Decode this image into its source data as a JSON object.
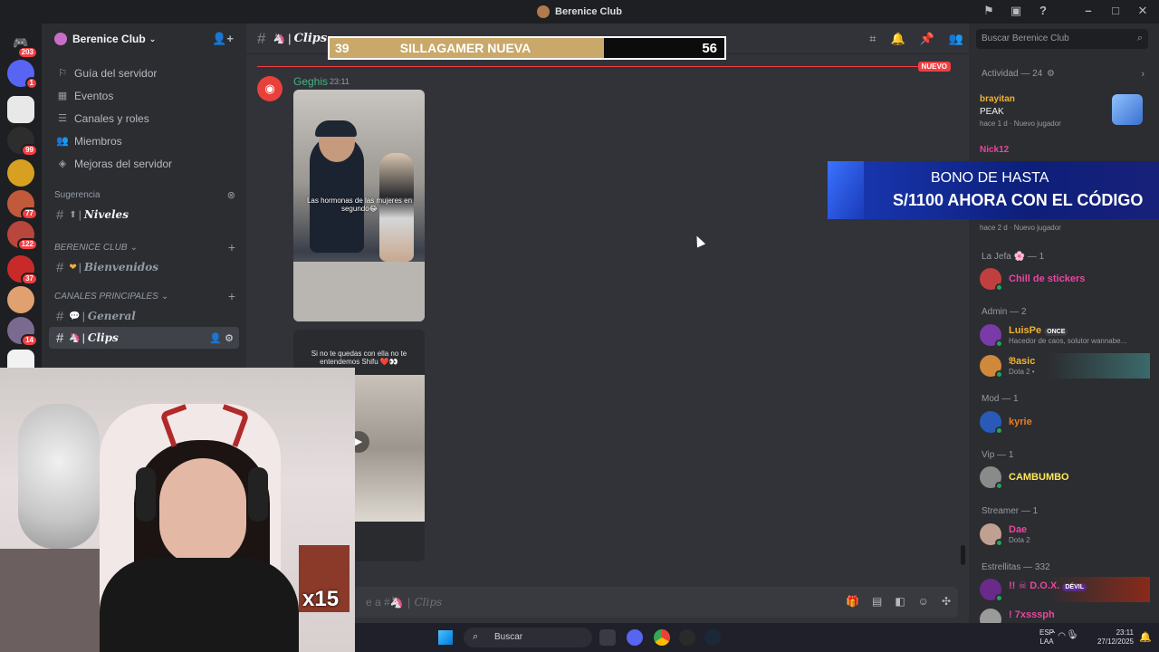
{
  "window": {
    "title": "Berenice Club"
  },
  "rail": {
    "badges": [
      "203",
      "1",
      "99",
      "77",
      "122",
      "37",
      "14"
    ]
  },
  "sidebar": {
    "server_name": "Berenice Club",
    "nav": [
      {
        "label": "Guía del servidor",
        "icon": "signpost-icon"
      },
      {
        "label": "Eventos",
        "icon": "calendar-icon"
      },
      {
        "label": "Canales y roles",
        "icon": "list-icon"
      },
      {
        "label": "Miembros",
        "icon": "members-icon"
      },
      {
        "label": "Mejoras del servidor",
        "icon": "boost-icon"
      }
    ],
    "suggestion_label": "Sugerencia",
    "suggestion_channel": "Niveles",
    "categories": [
      {
        "name": "BERENICE CLUB",
        "channels": [
          {
            "emoji": "❤",
            "name": "Bienvenidos"
          }
        ]
      },
      {
        "name": "CANALES PRINCIPALES",
        "channels": [
          {
            "emoji": "💬",
            "name": "General"
          },
          {
            "emoji": "🦄",
            "name": "Clips"
          }
        ]
      }
    ]
  },
  "chat": {
    "channel_name": "Clips",
    "new_label": "NUEVO",
    "message": {
      "author": "Geghis",
      "time": "23:11",
      "clip1_caption": "Las hormonas de las mujeres en segundo😂",
      "clip2_caption": "Si no te quedas con ella no te entendemos Shifu ❤️👀"
    },
    "composer_placeholder_prefix": "e a #🦄",
    "composer_placeholder_channel": "| Clips"
  },
  "members": {
    "search_placeholder": "Buscar Berenice Club",
    "activity_header": "Actividad — 24",
    "activity": [
      {
        "name": "brayitan",
        "game": "PEAK",
        "meta": "hace 1 d  ·  Nuevo jugador"
      },
      {
        "name": "Nick12",
        "game": "",
        "meta": ""
      },
      {
        "name": "",
        "game": "",
        "meta": "hace 2 d  ·  Nuevo jugador"
      }
    ],
    "groups": [
      {
        "header": "La Jefa 🌸 — 1",
        "members": [
          {
            "name": "Chill de stickers",
            "color": "#eb459e",
            "sub": ""
          }
        ]
      },
      {
        "header": "Admin — 2",
        "members": [
          {
            "name": "LuisPe",
            "color": "#f0b232",
            "tag": "ONCE",
            "sub": "Hacedor de caos, solutor wannabe..."
          },
          {
            "name": "𝔅asic",
            "color": "#f0b232",
            "sub": "Dota 2 •"
          }
        ]
      },
      {
        "header": "Mod — 1",
        "members": [
          {
            "name": "kyrie",
            "color": "#e67e22",
            "sub": ""
          }
        ]
      },
      {
        "header": "Vip — 1",
        "members": [
          {
            "name": "CAMBUMBO",
            "color": "#fee75c",
            "sub": ""
          }
        ]
      },
      {
        "header": "Streamer — 1",
        "members": [
          {
            "name": "Dae",
            "color": "#eb459e",
            "sub": "Dota 2"
          }
        ]
      },
      {
        "header": "Estrellitas — 332",
        "members": [
          {
            "name": "!! ☠ D.O.X.",
            "color": "#eb459e",
            "tag": "DÉVIL",
            "sub": ""
          },
          {
            "name": "! 7xsssph",
            "color": "#eb459e",
            "sub": ""
          }
        ]
      }
    ]
  },
  "overlays": {
    "goal_left": "39",
    "goal_title": "SILLAGAMER NUEVA",
    "goal_right": "56",
    "goal_fill_pct": 69.6,
    "promo_line1": "BONO DE HASTA",
    "promo_line2": "S/1100 AHORA CON EL CÓDIGO",
    "multiplier": "x15"
  },
  "taskbar": {
    "search": "Buscar",
    "lang1": "ESP",
    "lang2": "LAA",
    "time": "23:11",
    "date": "27/12/2025"
  }
}
